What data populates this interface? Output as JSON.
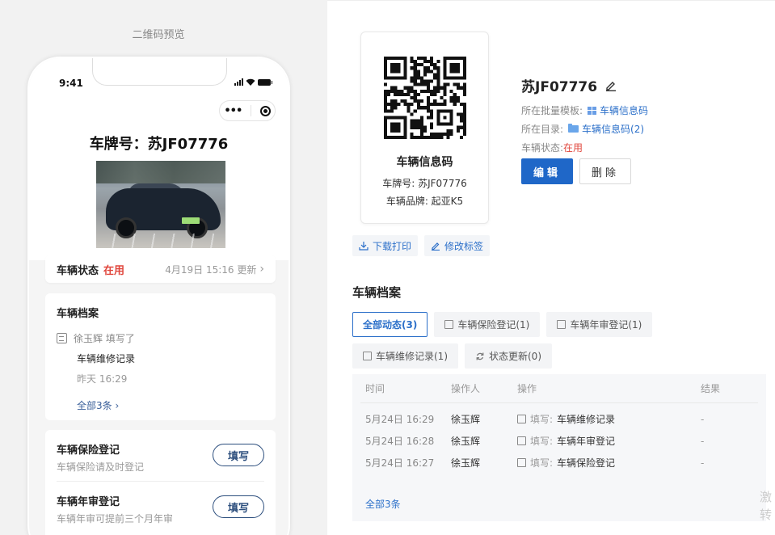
{
  "preview": {
    "title": "二维码预览",
    "status_time": "9:41",
    "plate_title": "车牌号：苏JF07776",
    "status_card": {
      "label": "车辆状态",
      "value": "在用",
      "updated": "4月19日 15:16 更新"
    },
    "archive": {
      "heading": "车辆档案",
      "entry_actor": "徐玉辉 填写了",
      "entry_title": "车辆维修记录",
      "entry_time": "昨天 16:29",
      "more": "全部3条"
    },
    "forms": [
      {
        "title": "车辆保险登记",
        "desc": "车辆保险请及时登记",
        "button": "填写"
      },
      {
        "title": "车辆年审登记",
        "desc": "车辆年审可提前三个月年审",
        "button": "填写"
      }
    ]
  },
  "qr_card": {
    "name": "车辆信息码",
    "plate_line": "车牌号: 苏JF07776",
    "brand_line": "车辆品牌: 起亚K5"
  },
  "info": {
    "title": "苏JF07776",
    "template_label": "所在批量模板:",
    "template_value": "车辆信息码",
    "dir_label": "所在目录:",
    "dir_value": "车辆信息码(2)",
    "status_label": "车辆状态:",
    "status_value": "在用",
    "edit_label": "编辑",
    "delete_label": "删除"
  },
  "actions": {
    "download": "下载打印",
    "edit_tag": "修改标签"
  },
  "archive_section": {
    "heading": "车辆档案",
    "filters": [
      "全部动态(3)",
      "车辆保险登记(1)",
      "车辆年审登记(1)",
      "车辆维修记录(1)",
      "状态更新(0)"
    ],
    "columns": [
      "时间",
      "操作人",
      "操作",
      "结果"
    ],
    "rows": [
      {
        "time": "5月24日 16:29",
        "operator": "徐玉辉",
        "action_prefix": "填写:",
        "action": "车辆维修记录",
        "result": "-"
      },
      {
        "time": "5月24日 16:28",
        "operator": "徐玉辉",
        "action_prefix": "填写:",
        "action": "车辆年审登记",
        "result": "-"
      },
      {
        "time": "5月24日 16:27",
        "operator": "徐玉辉",
        "action_prefix": "填写:",
        "action": "车辆保险登记",
        "result": "-"
      }
    ],
    "more": "全部3条"
  },
  "watermark": {
    "line1": "激",
    "line2": "转"
  },
  "colors": {
    "accent": "#1f67c8",
    "link": "#2b6fc9",
    "status_red": "#e0463c"
  }
}
